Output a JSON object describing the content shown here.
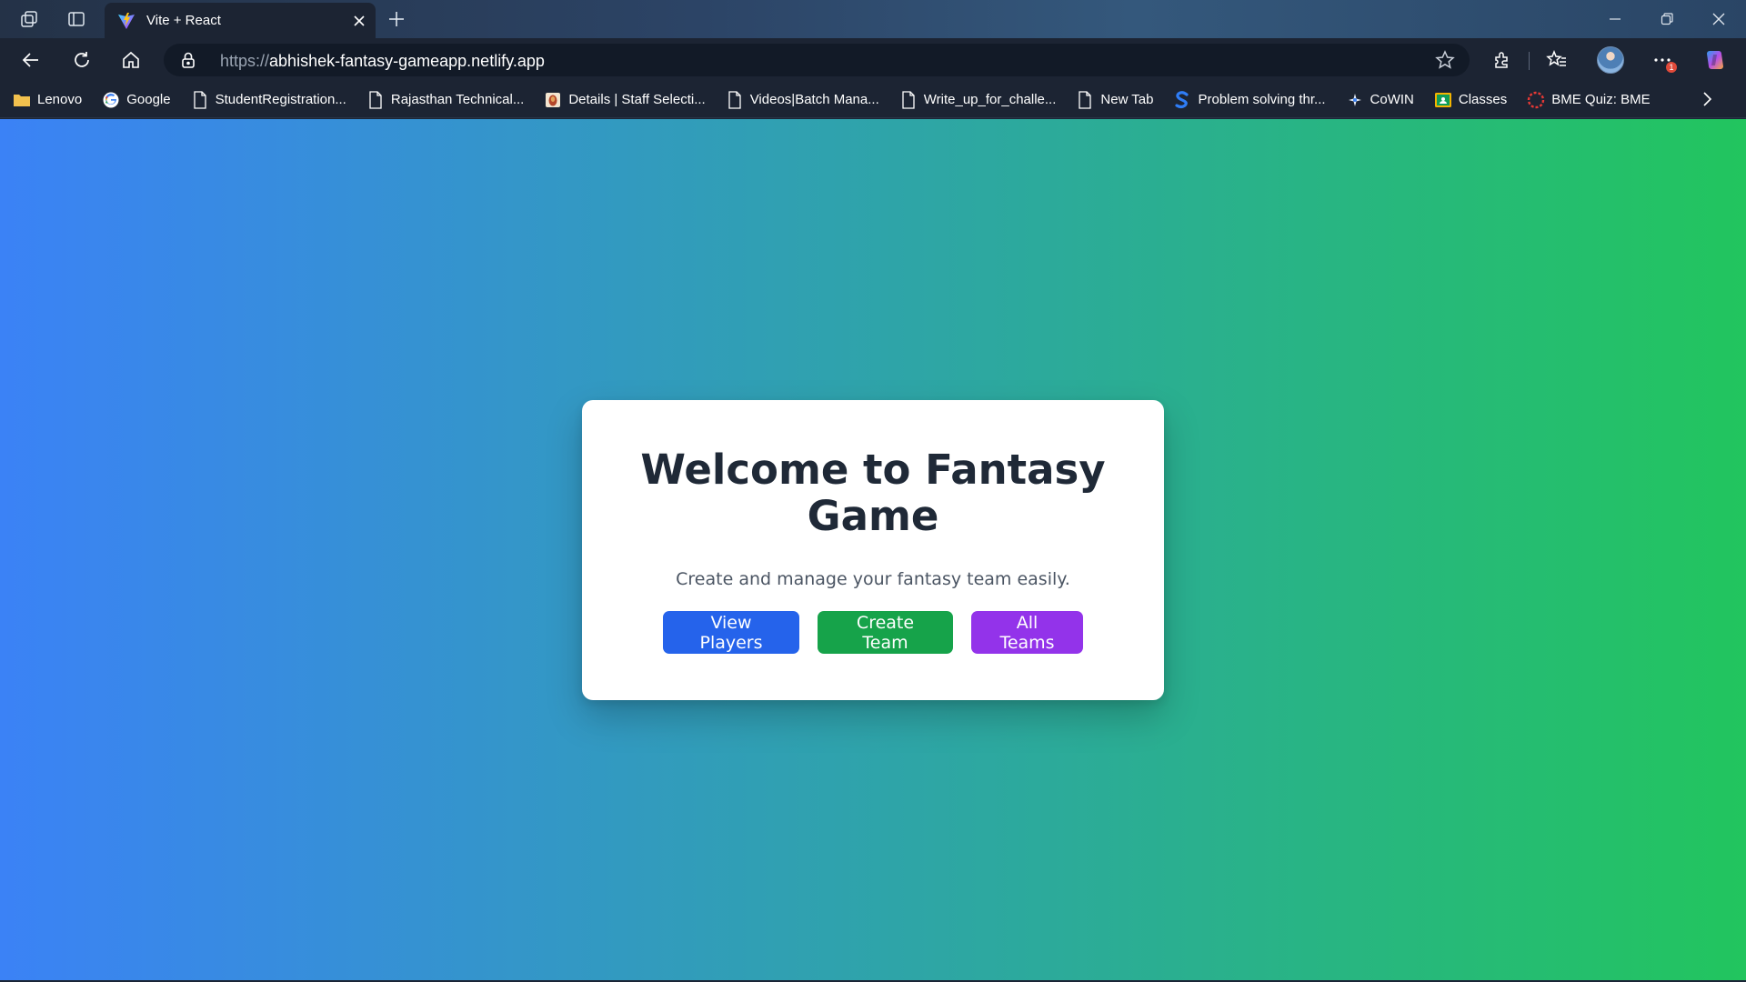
{
  "browser": {
    "tab": {
      "title": "Vite + React"
    },
    "address": {
      "scheme": "https://",
      "host": "abhishek-fantasy-gameapp.netlify.app"
    },
    "notification_count": "1",
    "bookmarks": [
      {
        "label": "Lenovo",
        "icon": "folder-icon"
      },
      {
        "label": "Google",
        "icon": "google-icon"
      },
      {
        "label": "StudentRegistration...",
        "icon": "page-icon"
      },
      {
        "label": "Rajasthan Technical...",
        "icon": "page-icon"
      },
      {
        "label": "Details | Staff Selecti...",
        "icon": "emblem-icon"
      },
      {
        "label": "Videos|Batch Mana...",
        "icon": "page-icon"
      },
      {
        "label": "Write_up_for_challe...",
        "icon": "page-icon"
      },
      {
        "label": "New Tab",
        "icon": "page-icon"
      },
      {
        "label": "Problem solving thr...",
        "icon": "s-logo-icon"
      },
      {
        "label": "CoWIN",
        "icon": "cowin-icon"
      },
      {
        "label": "Classes",
        "icon": "classroom-icon"
      },
      {
        "label": "BME Quiz: BME",
        "icon": "quiz-icon"
      }
    ]
  },
  "page": {
    "heading": "Welcome to Fantasy Game",
    "subtitle": "Create and manage your fantasy team easily.",
    "buttons": {
      "view_players": "View Players",
      "create_team": "Create Team",
      "all_teams": "All Teams"
    }
  },
  "colors": {
    "gradient_start": "#3b82f6",
    "gradient_end": "#22c55e",
    "btn_blue": "#2563eb",
    "btn_green": "#16a34a",
    "btn_purple": "#9333ea",
    "heading": "#1f2937"
  }
}
